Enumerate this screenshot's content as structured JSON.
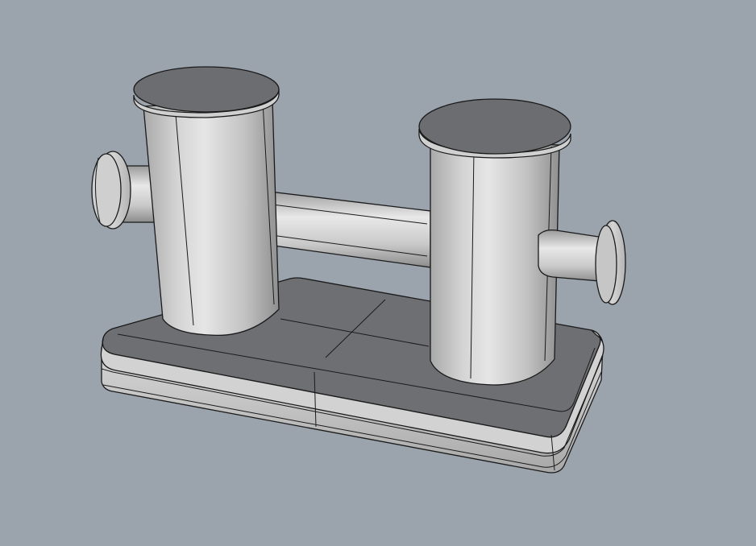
{
  "viewport": {
    "background_color": "#9ba3ad",
    "object": "double-bitt-mooring-bollard",
    "shading": "shaded-with-edges",
    "colors": {
      "light_metal": "#d8d8d8",
      "mid_metal": "#bdbdbd",
      "dark_metal": "#8a8a8a",
      "top_cap": "#6c6d70",
      "base_top": "#6e6f72",
      "edge": "#1a1a1a"
    }
  }
}
